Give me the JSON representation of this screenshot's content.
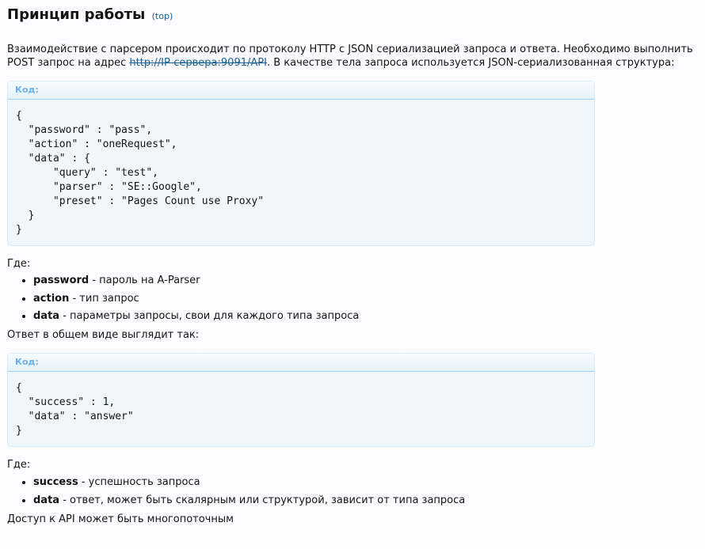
{
  "heading": {
    "title": "Принцип работы",
    "top_link": "(top)"
  },
  "intro": {
    "text_before": "Взаимодействие с парсером происходит по протоколу HTTP с JSON сериализацией запроса и ответа. Необходимо выполнить POST запрос на адрес ",
    "url": "http://IP-сервера:9091/API",
    "text_after": ". В качестве тела запроса используется JSON-сериализованная структура:"
  },
  "request_code": {
    "label": "Код:",
    "code": "{\n  \"password\" : \"pass\",\n  \"action\" : \"oneRequest\",\n  \"data\" : {\n      \"query\" : \"test\",\n      \"parser\" : \"SE::Google\",\n      \"preset\" : \"Pages Count use Proxy\"\n  }\n}"
  },
  "where1": "Где:",
  "request_fields": [
    {
      "name": "password",
      "desc": " - пароль на A-Parser"
    },
    {
      "name": "action",
      "desc": " - тип запрос"
    },
    {
      "name": "data",
      "desc": " - параметры запросы, свои для каждого типа запроса"
    }
  ],
  "response_intro": "Ответ в общем виде выглядит так:",
  "response_code": {
    "label": "Код:",
    "code": "{\n  \"success\" : 1,\n  \"data\" : \"answer\"\n}"
  },
  "where2": "Где:",
  "response_fields": [
    {
      "name": "success",
      "desc": " - успешность запроса"
    },
    {
      "name": "data",
      "desc": " - ответ, может быть скалярным или структурой, зависит от типа запроса"
    }
  ],
  "footer_note": "Доступ к API может быть многопоточным"
}
